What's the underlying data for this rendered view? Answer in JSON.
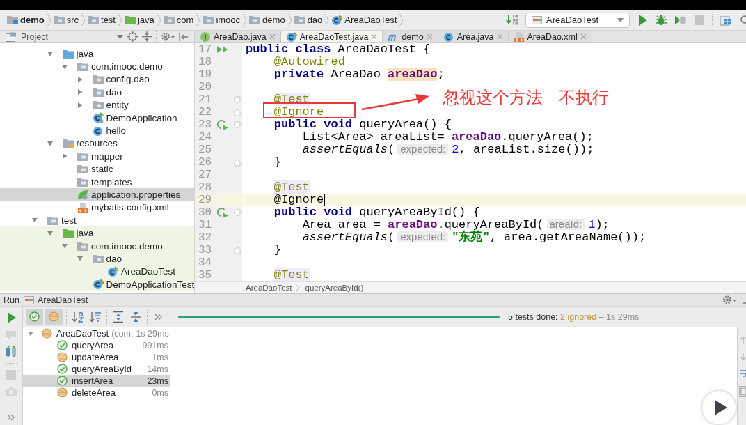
{
  "breadcrumbs": [
    {
      "label": "demo",
      "kind": "module"
    },
    {
      "label": "src",
      "kind": "folder"
    },
    {
      "label": "test",
      "kind": "folder"
    },
    {
      "label": "java",
      "kind": "test-root"
    },
    {
      "label": "com",
      "kind": "package"
    },
    {
      "label": "imooc",
      "kind": "package"
    },
    {
      "label": "demo",
      "kind": "package"
    },
    {
      "label": "dao",
      "kind": "package"
    },
    {
      "label": "AreaDaoTest",
      "kind": "test-class"
    }
  ],
  "run_toolbar": {
    "config": "AreaDaoTest"
  },
  "project_panel": {
    "title": "Project"
  },
  "editor_tabs": [
    {
      "label": "AreaDao.java",
      "kind": "interface",
      "selected": false
    },
    {
      "label": "AreaDaoTest.java",
      "kind": "test-class",
      "selected": true
    },
    {
      "label": "demo",
      "kind": "maven",
      "selected": false
    },
    {
      "label": "Area.java",
      "kind": "class",
      "selected": false
    },
    {
      "label": "AreaDao.xml",
      "kind": "xml",
      "selected": false
    }
  ],
  "project_tree": {
    "children": [
      {
        "children": [
          {
            "label": "java",
            "kind": "source-root",
            "expanded": true,
            "selected": false,
            "children": [
              {
                "label": "com.imooc.demo",
                "kind": "package",
                "expanded": true,
                "selected": false,
                "children": [
                  {
                    "label": "config.dao",
                    "kind": "package",
                    "expanded": false,
                    "selected": false
                  },
                  {
                    "label": "dao",
                    "kind": "package",
                    "expanded": false,
                    "selected": false
                  },
                  {
                    "label": "entity",
                    "kind": "package",
                    "expanded": false,
                    "selected": false
                  },
                  {
                    "label": "DemoApplication",
                    "kind": "spring-class",
                    "selected": false
                  },
                  {
                    "label": "hello",
                    "kind": "class",
                    "selected": false
                  }
                ]
              }
            ]
          },
          {
            "label": "resources",
            "kind": "resources-root",
            "expanded": true,
            "selected": false,
            "children": [
              {
                "label": "mapper",
                "kind": "folder",
                "expanded": false,
                "selected": false
              },
              {
                "label": "static",
                "kind": "folder",
                "selected": false
              },
              {
                "label": "templates",
                "kind": "folder",
                "selected": false
              },
              {
                "label": "application.properties",
                "kind": "spring-properties",
                "selected": true
              },
              {
                "label": "mybatis-config.xml",
                "kind": "xml",
                "selected": false
              }
            ]
          }
        ]
      },
      {
        "label": "test",
        "kind": "folder",
        "expanded": true,
        "selected": false,
        "children": [
          {
            "label": "java",
            "kind": "test-root",
            "expanded": true,
            "selected": false,
            "children": [
              {
                "label": "com.imooc.demo",
                "kind": "package",
                "expanded": true,
                "selected": false,
                "children": [
                  {
                    "label": "dao",
                    "kind": "package",
                    "expanded": true,
                    "selected": false,
                    "children": [
                      {
                        "label": "AreaDaoTest",
                        "kind": "test-class",
                        "selected": false
                      }
                    ]
                  },
                  {
                    "label": "DemoApplicationTest",
                    "kind": "test-class",
                    "selected": false
                  }
                ]
              }
            ]
          }
        ]
      }
    ]
  },
  "editor": {
    "lines": [
      {
        "number": "17",
        "gutter": {
          "kind": "run-class"
        },
        "caret": false,
        "tokens": [
          {
            "text": "public class",
            "kind": "keyword"
          },
          {
            "text": " AreaDaoTest {",
            "kind": "plain"
          }
        ]
      },
      {
        "number": "18",
        "caret": false,
        "tokens": [
          {
            "text": "    @Autowired",
            "kind": "annotation"
          }
        ]
      },
      {
        "number": "19",
        "caret": false,
        "tokens": [
          {
            "text": "    private",
            "kind": "keyword"
          },
          {
            "text": " AreaDao ",
            "kind": "plain"
          },
          {
            "text": "areaDao",
            "kind": "declared-field"
          },
          {
            "text": ";",
            "kind": "plain"
          }
        ]
      },
      {
        "number": "20",
        "caret": false
      },
      {
        "number": "21",
        "fold": {
          "kind": "start"
        },
        "caret": false,
        "tokens": [
          {
            "text": "    @Test",
            "kind": "marked-annotation"
          }
        ]
      },
      {
        "number": "22",
        "fold": {
          "kind": "end"
        },
        "caret": false,
        "tokens": [
          {
            "text": "    @Ignore",
            "kind": "annotation"
          }
        ]
      },
      {
        "number": "23",
        "gutter": {
          "kind": "run-test"
        },
        "fold": {
          "kind": "start"
        },
        "caret": false,
        "tokens": [
          {
            "text": "    public void",
            "kind": "keyword"
          },
          {
            "text": " queryArea() {",
            "kind": "plain"
          }
        ]
      },
      {
        "number": "24",
        "caret": false,
        "tokens": [
          {
            "text": "        List<Area> areaList= ",
            "kind": "plain"
          },
          {
            "text": "areaDao",
            "kind": "field"
          },
          {
            "text": ".queryArea();",
            "kind": "plain"
          }
        ]
      },
      {
        "number": "25",
        "caret": false,
        "tokens": [
          {
            "text": "        assertEquals",
            "kind": "call"
          },
          {
            "text": "(",
            "kind": "plain"
          },
          {
            "text": "expected:",
            "kind": "hint"
          },
          {
            "text": "2",
            "kind": "number"
          },
          {
            "text": ", areaList.size());",
            "kind": "plain"
          }
        ]
      },
      {
        "number": "26",
        "fold": {
          "kind": "end"
        },
        "caret": false,
        "tokens": [
          {
            "text": "    }",
            "kind": "plain"
          }
        ]
      },
      {
        "number": "27",
        "caret": false
      },
      {
        "number": "28",
        "caret": false,
        "tokens": [
          {
            "text": "    @Test",
            "kind": "marked-annotation"
          }
        ]
      },
      {
        "number": "29",
        "caret": true,
        "tokens": [
          {
            "text": "    @Ignore",
            "kind": "plain"
          }
        ]
      },
      {
        "number": "30",
        "gutter": {
          "kind": "run-test"
        },
        "fold": {
          "kind": "start"
        },
        "caret": false,
        "tokens": [
          {
            "text": "    public void",
            "kind": "keyword"
          },
          {
            "text": " queryAreaById() {",
            "kind": "plain"
          }
        ]
      },
      {
        "number": "31",
        "caret": false,
        "tokens": [
          {
            "text": "        Area area = ",
            "kind": "plain"
          },
          {
            "text": "areaDao",
            "kind": "field"
          },
          {
            "text": ".queryAreaById(",
            "kind": "plain"
          },
          {
            "text": "areaId:",
            "kind": "hint"
          },
          {
            "text": "1",
            "kind": "number"
          },
          {
            "text": ");",
            "kind": "plain"
          }
        ]
      },
      {
        "number": "32",
        "caret": false,
        "tokens": [
          {
            "text": "        assertEquals",
            "kind": "call"
          },
          {
            "text": "(",
            "kind": "plain"
          },
          {
            "text": "expected:",
            "kind": "hint"
          },
          {
            "text": "\"东苑\"",
            "kind": "string"
          },
          {
            "text": ", area.getAreaName());",
            "kind": "plain"
          }
        ]
      },
      {
        "number": "33",
        "fold": {
          "kind": "end"
        },
        "caret": false,
        "tokens": [
          {
            "text": "    }",
            "kind": "plain"
          }
        ]
      },
      {
        "number": "34",
        "caret": false
      },
      {
        "number": "35",
        "caret": false,
        "tokens": [
          {
            "text": "    @Test",
            "kind": "marked-annotation"
          }
        ]
      }
    ],
    "breadcrumb": [
      "AreaDaoTest",
      "queryAreaById()"
    ]
  },
  "annotation": {
    "note": "忽视这个方法   不执行"
  },
  "run_panel": {
    "title": "Run",
    "config": "AreaDaoTest",
    "filters": [
      {
        "kind": "passed",
        "on": true
      },
      {
        "kind": "ignored",
        "on": true
      }
    ],
    "progress": {
      "level": 1
    },
    "summary": {
      "done": "5 tests done:",
      "ignored": "2 ignored",
      "time": "– 1s 29ms"
    },
    "results": [
      {
        "name": "AreaDaoTest",
        "detail": "(com.",
        "time": "1s 29ms",
        "ignored": true,
        "expanded": true,
        "selected": false,
        "children": [
          {
            "name": "queryArea",
            "time": "991ms",
            "ignored": false,
            "selected": false
          },
          {
            "name": "updateArea",
            "time": "1ms",
            "ignored": true,
            "selected": false
          },
          {
            "name": "queryAreaById",
            "time": "14ms",
            "ignored": false,
            "selected": false
          },
          {
            "name": "insertArea",
            "time": "23ms",
            "ignored": false,
            "selected": true
          },
          {
            "name": "deleteArea",
            "time": "0ms",
            "ignored": true,
            "selected": false
          }
        ]
      }
    ]
  },
  "video_player": {
    "paused": true
  }
}
